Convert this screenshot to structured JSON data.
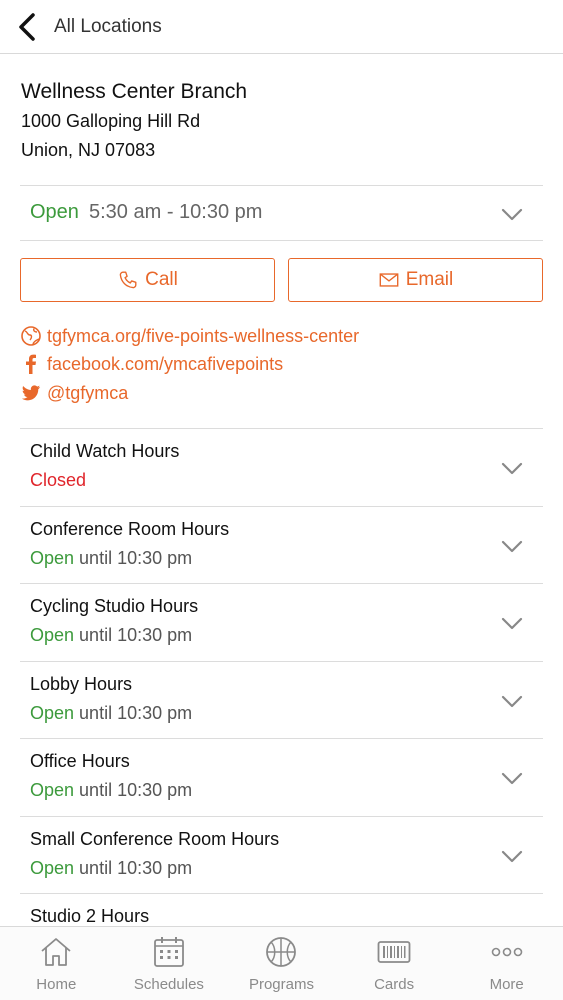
{
  "header": {
    "back_label": "All Locations"
  },
  "location": {
    "name": "Wellness Center Branch",
    "address_line1": "1000 Galloping Hill Rd",
    "address_line2": "Union, NJ 07083",
    "status": "Open",
    "hours": "5:30 am - 10:30 pm"
  },
  "actions": {
    "call_label": "Call",
    "email_label": "Email"
  },
  "links": {
    "website": "tgfymca.org/five-points-wellness-center",
    "facebook": "facebook.com/ymcafivepoints",
    "twitter": "@tgfymca"
  },
  "facilities": [
    {
      "name": "Child Watch Hours",
      "status": "Closed",
      "detail": ""
    },
    {
      "name": "Conference Room Hours",
      "status": "Open",
      "detail": " until 10:30 pm"
    },
    {
      "name": "Cycling Studio Hours",
      "status": "Open",
      "detail": " until 10:30 pm"
    },
    {
      "name": "Lobby Hours",
      "status": "Open",
      "detail": " until 10:30 pm"
    },
    {
      "name": "Office Hours",
      "status": "Open",
      "detail": " until 10:30 pm"
    },
    {
      "name": "Small Conference Room Hours",
      "status": "Open",
      "detail": " until 10:30 pm"
    },
    {
      "name": "Studio 2 Hours",
      "status": "",
      "detail": ""
    }
  ],
  "tabs": [
    {
      "label": "Home",
      "icon": "home-icon"
    },
    {
      "label": "Schedules",
      "icon": "calendar-icon"
    },
    {
      "label": "Programs",
      "icon": "basketball-icon"
    },
    {
      "label": "Cards",
      "icon": "barcode-card-icon"
    },
    {
      "label": "More",
      "icon": "more-dots-icon"
    }
  ],
  "colors": {
    "accent": "#e8682b",
    "open": "#3c9a3c",
    "closed": "#e0252b"
  }
}
